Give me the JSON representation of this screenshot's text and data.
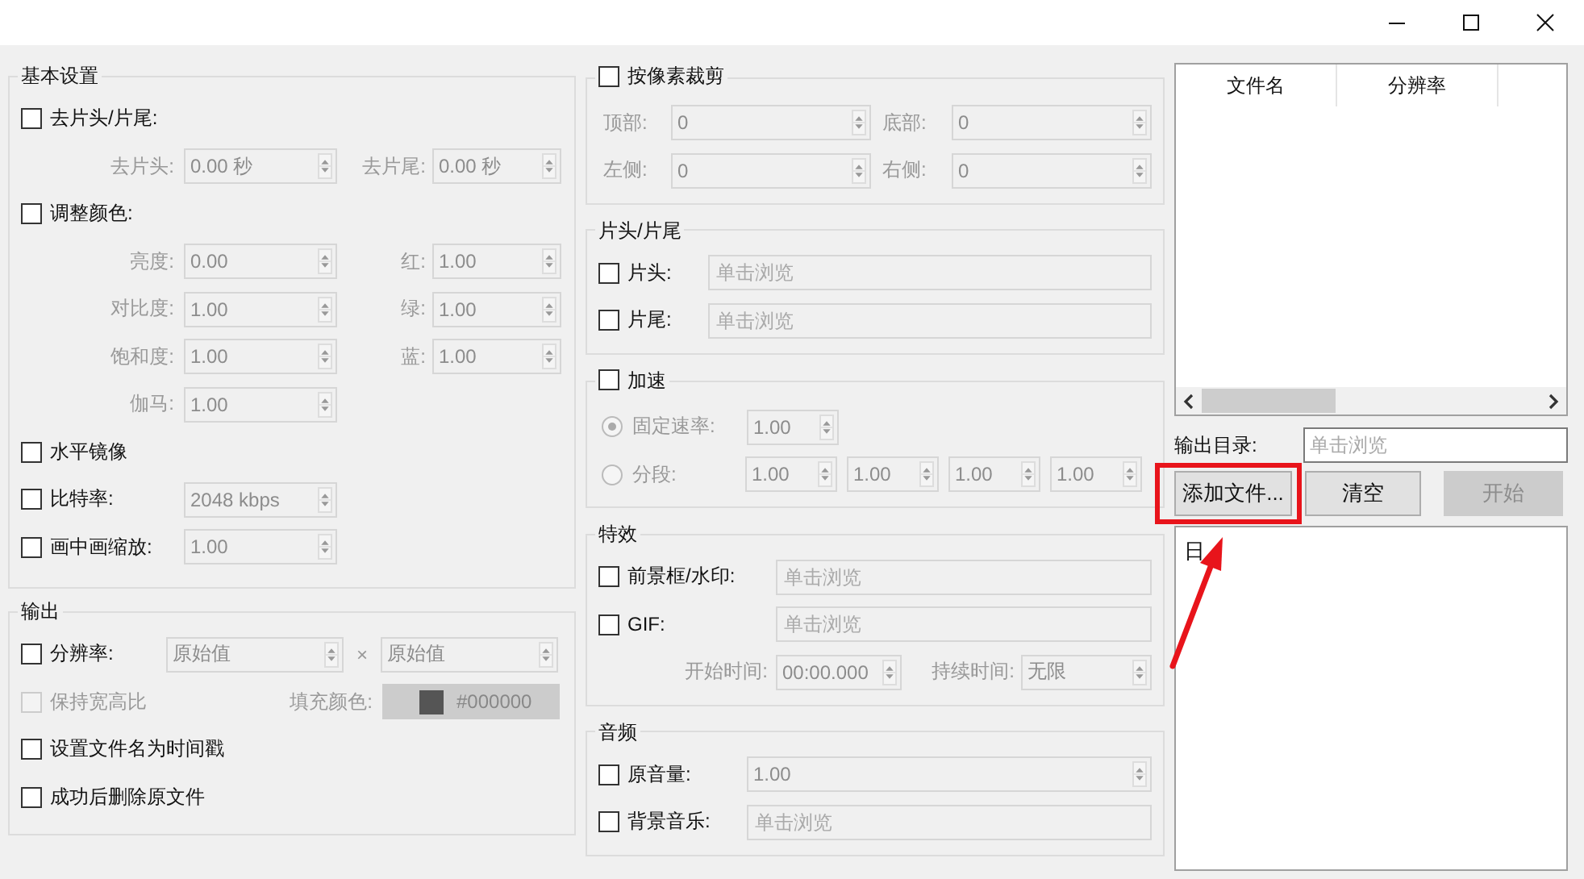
{
  "columns": [
    [
      {
        "kind": "basic",
        "title": {
          "kind": "text",
          "label": "基本设置"
        },
        "rows": [
          {
            "kind": "check",
            "label": "去片头/片尾:",
            "checked": false,
            "disabled": false
          },
          {
            "kind": "fields",
            "fields": [
              {
                "label": "去片头:",
                "value": "0.00 秒",
                "kind": "spin"
              },
              {
                "label": "去片尾:",
                "value": "0.00 秒",
                "kind": "spin"
              }
            ]
          },
          {
            "kind": "check",
            "label": "调整颜色:",
            "checked": false,
            "disabled": false
          },
          {
            "kind": "fields",
            "fields": [
              {
                "label": "亮度:",
                "value": "0.00",
                "kind": "spin"
              },
              {
                "label": "红:",
                "value": "1.00",
                "kind": "spin"
              }
            ]
          },
          {
            "kind": "fields",
            "fields": [
              {
                "label": "对比度:",
                "value": "1.00",
                "kind": "spin"
              },
              {
                "label": "绿:",
                "value": "1.00",
                "kind": "spin"
              }
            ]
          },
          {
            "kind": "fields",
            "fields": [
              {
                "label": "饱和度:",
                "value": "1.00",
                "kind": "spin"
              },
              {
                "label": "蓝:",
                "value": "1.00",
                "kind": "spin"
              }
            ]
          },
          {
            "kind": "fields",
            "fields": [
              {
                "label": "伽马:",
                "value": "1.00",
                "kind": "spin"
              }
            ]
          },
          {
            "kind": "check",
            "label": "水平镜像",
            "checked": false,
            "disabled": false
          },
          {
            "kind": "check",
            "label": "比特率:",
            "checked": false,
            "disabled": false,
            "fields": [
              {
                "value": "2048 kbps",
                "kind": "spin"
              }
            ]
          },
          {
            "kind": "check",
            "label": "画中画缩放:",
            "checked": false,
            "disabled": false,
            "fields": [
              {
                "value": "1.00",
                "kind": "spin"
              }
            ]
          }
        ]
      },
      {
        "kind": "output",
        "title": {
          "kind": "text",
          "label": "输出"
        },
        "rows": [
          {
            "kind": "check",
            "label": "分辨率:",
            "checked": false,
            "disabled": false,
            "fields": [
              {
                "value": "原始值",
                "kind": "spin"
              },
              {
                "label": "×",
                "value": "原始值",
                "kind": "spin"
              }
            ]
          },
          {
            "kind": "check",
            "label": "保持宽高比",
            "checked": false,
            "disabled": true,
            "fields": [
              {
                "label": "填充颜色:",
                "value": "#000000",
                "kind": "color"
              }
            ]
          },
          {
            "kind": "check",
            "label": "设置文件名为时间戳",
            "checked": false,
            "disabled": false
          },
          {
            "kind": "check",
            "label": "成功后删除原文件",
            "checked": false,
            "disabled": false
          }
        ]
      }
    ],
    [
      {
        "kind": "crop",
        "title": {
          "kind": "check",
          "label": "按像素裁剪",
          "checked": false
        },
        "rows": [
          {
            "kind": "fields",
            "fields": [
              {
                "label": "顶部:",
                "value": "0",
                "kind": "spin"
              },
              {
                "label": "底部:",
                "value": "0",
                "kind": "spin"
              }
            ]
          },
          {
            "kind": "fields",
            "fields": [
              {
                "label": "左侧:",
                "value": "0",
                "kind": "spin"
              },
              {
                "label": "右侧:",
                "value": "0",
                "kind": "spin"
              }
            ]
          }
        ]
      },
      {
        "kind": "clips",
        "title": {
          "kind": "text",
          "label": "片头/片尾"
        },
        "rows": [
          {
            "kind": "check",
            "label": "片头:",
            "checked": false,
            "disabled": false,
            "fields": [
              {
                "placeholder": "单击浏览",
                "kind": "browse"
              }
            ]
          },
          {
            "kind": "check",
            "label": "片尾:",
            "checked": false,
            "disabled": false,
            "fields": [
              {
                "placeholder": "单击浏览",
                "kind": "browse"
              }
            ]
          }
        ]
      },
      {
        "kind": "speed",
        "title": {
          "kind": "check",
          "label": "加速",
          "checked": false
        },
        "rows": [
          {
            "kind": "radio",
            "label": "固定速率:",
            "selected": true,
            "disabled": true,
            "fields": [
              {
                "value": "1.00",
                "kind": "spin"
              }
            ]
          },
          {
            "kind": "radio",
            "label": "分段:",
            "selected": false,
            "disabled": true,
            "fields": [
              {
                "value": "1.00",
                "kind": "spin"
              },
              {
                "value": "1.00",
                "kind": "spin"
              },
              {
                "value": "1.00",
                "kind": "spin"
              },
              {
                "value": "1.00",
                "kind": "spin"
              }
            ]
          }
        ]
      },
      {
        "kind": "effects",
        "title": {
          "kind": "text",
          "label": "特效"
        },
        "rows": [
          {
            "kind": "check",
            "label": "前景框/水印:",
            "checked": false,
            "disabled": false,
            "fields": [
              {
                "placeholder": "单击浏览",
                "kind": "browse"
              }
            ]
          },
          {
            "kind": "check",
            "label": "GIF:",
            "checked": false,
            "disabled": false,
            "fields": [
              {
                "placeholder": "单击浏览",
                "kind": "browse"
              }
            ]
          },
          {
            "kind": "fields",
            "fields": [
              {
                "label": "开始时间:",
                "value": "00:00.000",
                "kind": "spin"
              },
              {
                "label": "持续时间:",
                "value": "无限",
                "kind": "spin"
              }
            ]
          }
        ]
      },
      {
        "kind": "audio",
        "title": {
          "kind": "text",
          "label": "音频"
        },
        "rows": [
          {
            "kind": "check",
            "label": "原音量:",
            "checked": false,
            "disabled": false,
            "fields": [
              {
                "value": "1.00",
                "kind": "spin"
              }
            ]
          },
          {
            "kind": "check",
            "label": "背景音乐:",
            "checked": false,
            "disabled": false,
            "fields": [
              {
                "placeholder": "单击浏览",
                "kind": "browse"
              }
            ]
          }
        ]
      }
    ]
  ],
  "file_table": {
    "columns": [
      "文件名",
      "分辨率"
    ]
  },
  "output_dir": {
    "label": "输出目录:",
    "placeholder": "单击浏览"
  },
  "buttons": [
    {
      "label": "添加文件...",
      "disabled": false
    },
    {
      "label": "清空",
      "disabled": false
    },
    {
      "label": "开始",
      "disabled": true
    }
  ],
  "log": {
    "text": "日"
  }
}
